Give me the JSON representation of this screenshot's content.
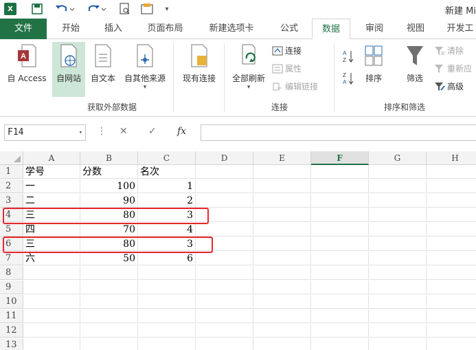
{
  "window": {
    "title": "新建 Mi"
  },
  "tabs": [
    {
      "label": "文件"
    },
    {
      "label": "开始"
    },
    {
      "label": "插入"
    },
    {
      "label": "页面布局"
    },
    {
      "label": "新建选项卡"
    },
    {
      "label": "公式"
    },
    {
      "label": "数据"
    },
    {
      "label": "审阅"
    },
    {
      "label": "视图"
    },
    {
      "label": "开发工"
    }
  ],
  "ribbon": {
    "get_external": {
      "access": "自 Access",
      "web": "自网站",
      "text": "自文本",
      "other": "自其他来源",
      "existing": "现有连接",
      "group_label": "获取外部数据"
    },
    "connections": {
      "refresh_all": "全部刷新",
      "connections": "连接",
      "properties": "属性",
      "edit_links": "编辑链接",
      "group_label": "连接"
    },
    "sort_filter": {
      "sort": "排序",
      "filter": "筛选",
      "clear": "清除",
      "reapply": "重新应",
      "advanced": "高级",
      "group_label": "排序和筛选"
    }
  },
  "formula_bar": {
    "name_box": "F14",
    "fx": "fx",
    "formula": ""
  },
  "grid": {
    "columns": [
      "A",
      "B",
      "C",
      "D",
      "E",
      "F",
      "G",
      "H"
    ],
    "active_column": "F",
    "rows": [
      {
        "num": "1",
        "a": "学号",
        "b": "分数",
        "c": "名次"
      },
      {
        "num": "2",
        "a": "一",
        "b": "100",
        "c": "1"
      },
      {
        "num": "3",
        "a": "二",
        "b": "90",
        "c": "2"
      },
      {
        "num": "4",
        "a": "三",
        "b": "80",
        "c": "3"
      },
      {
        "num": "5",
        "a": "四",
        "b": "70",
        "c": "4"
      },
      {
        "num": "6",
        "a": "三",
        "b": "80",
        "c": "3"
      },
      {
        "num": "7",
        "a": "六",
        "b": "50",
        "c": "6"
      },
      {
        "num": "8",
        "a": "",
        "b": "",
        "c": ""
      },
      {
        "num": "9",
        "a": "",
        "b": "",
        "c": ""
      },
      {
        "num": "10",
        "a": "",
        "b": "",
        "c": ""
      },
      {
        "num": "11",
        "a": "",
        "b": "",
        "c": ""
      },
      {
        "num": "12",
        "a": "",
        "b": "",
        "c": ""
      },
      {
        "num": "13",
        "a": "",
        "b": "",
        "c": ""
      }
    ]
  },
  "colors": {
    "accent": "#217346",
    "highlight": "#e8262b"
  }
}
